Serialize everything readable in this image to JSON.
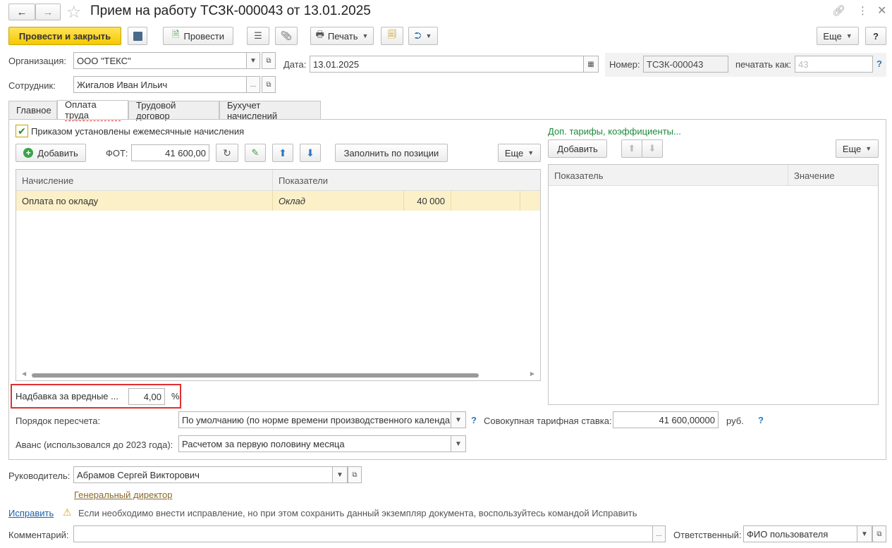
{
  "window": {
    "title": "Прием на работу ТСЗК-000043 от 13.01.2025"
  },
  "toolbar": {
    "post_close": "Провести и закрыть",
    "post": "Провести",
    "print": "Печать",
    "more": "Еще",
    "help": "?"
  },
  "header": {
    "org_label": "Организация:",
    "org_value": "ООО \"ТЕКС\"",
    "date_label": "Дата:",
    "date_value": "13.01.2025",
    "number_label": "Номер:",
    "number_value": "ТСЗК-000043",
    "print_as_label": "печатать как:",
    "print_as_value": "43",
    "help": "?",
    "employee_label": "Сотрудник:",
    "employee_value": "Жигалов Иван Ильич",
    "ellipsis": "..."
  },
  "tabs": [
    {
      "label": "Главное"
    },
    {
      "label": "Оплата труда"
    },
    {
      "label": "Трудовой договор"
    },
    {
      "label": "Бухучет начислений"
    }
  ],
  "pay": {
    "checkbox_label": "Приказом установлены ежемесячные начисления",
    "add": "Добавить",
    "fot_label": "ФОТ:",
    "fot_value": "41 600,00",
    "fill_by_position": "Заполнить по позиции",
    "more": "Еще",
    "grid": {
      "columns": [
        "Начисление",
        "Показатели"
      ],
      "rows": [
        {
          "accrual": "Оплата по окладу",
          "indicator": "Оклад",
          "value": "40 000"
        }
      ]
    },
    "harmful_label": "Надбавка за вредные ...",
    "harmful_value": "4,00",
    "harmful_unit": "%",
    "recalc_label": "Порядок пересчета:",
    "recalc_value": "По умолчанию (по норме времени производственного календаря)",
    "total_rate_label": "Совокупная тарифная ставка:",
    "total_rate_value": "41 600,00000",
    "total_rate_unit": "руб.",
    "help": "?",
    "advance_label": "Аванс (использовался до 2023 года):",
    "advance_value": "Расчетом за первую половину месяца"
  },
  "extra": {
    "link": "Доп. тарифы, коэффициенты...",
    "add": "Добавить",
    "more": "Еще",
    "columns": [
      "Показатель",
      "Значение"
    ]
  },
  "footer": {
    "manager_label": "Руководитель:",
    "manager_value": "Абрамов Сергей Викторович",
    "manager_position": "Генеральный директор",
    "fix_link": "Исправить",
    "fix_hint": "Если необходимо внести исправление, но при этом сохранить данный экземпляр документа, воспользуйтесь командой Исправить",
    "comment_label": "Комментарий:",
    "comment_value": "",
    "ellipsis": "...",
    "responsible_label": "Ответственный:",
    "responsible_value": "ФИО пользователя"
  },
  "colors": {
    "primary_button": "#f5c900",
    "selected_row": "#fbf0c8",
    "highlight_border": "#e03030",
    "link_green": "#1a8a3a",
    "link_blue": "#1f5fa8"
  }
}
